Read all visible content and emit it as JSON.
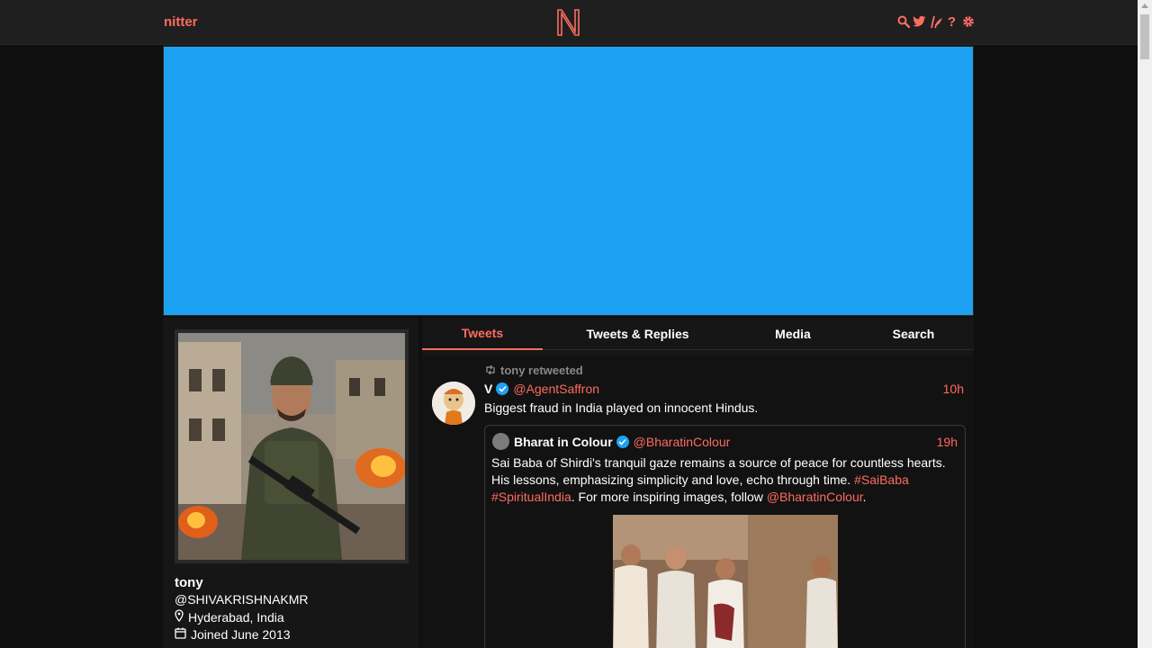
{
  "nav": {
    "brand": "nitter",
    "icons": [
      "search-icon",
      "twitter-icon",
      "rss-icon",
      "help-icon",
      "settings-icon"
    ],
    "help_glyph": "?"
  },
  "colors": {
    "accent": "#ff6c60",
    "banner": "#1da1f2",
    "background": "#0f0f0f"
  },
  "profile": {
    "name": "tony",
    "handle": "@SHIVAKRISHNAKMR",
    "location": "Hyderabad, India",
    "joined": "Joined June 2013"
  },
  "tabs": [
    {
      "label": "Tweets",
      "active": true
    },
    {
      "label": "Tweets & Replies",
      "active": false
    },
    {
      "label": "Media",
      "active": false
    },
    {
      "label": "Search",
      "active": false
    }
  ],
  "tweet": {
    "retweet_label": "tony retweeted",
    "fullname": "V",
    "username": "@AgentSaffron",
    "date": "10h",
    "text": "Biggest fraud in India played on innocent Hindus.",
    "quote": {
      "fullname": "Bharat in Colour",
      "username": "@BharatinColour",
      "date": "19h",
      "text_1": "Sai Baba of Shirdi's tranquil gaze remains a source of peace for countless hearts. His lessons, emphasizing simplicity and love, echo through time. ",
      "hashtag_1": "#SaiBaba",
      "hashtag_2": "#SpiritualIndia",
      "text_2": ". For more inspiring images, follow ",
      "mention": "@BharatinColour",
      "text_3": "."
    }
  }
}
